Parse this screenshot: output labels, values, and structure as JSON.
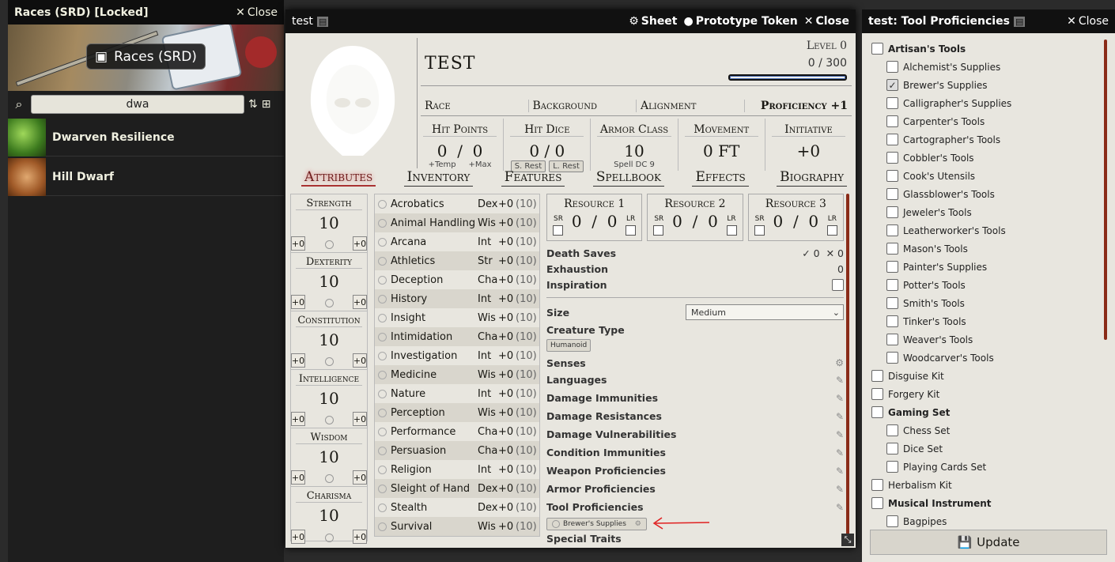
{
  "left_window": {
    "title": "Races (SRD) [Locked]",
    "close_label": "Close",
    "banner_label": "Races (SRD)",
    "search_value": "dwa",
    "results": [
      "Dwarven Resilience",
      "Hill Dwarf"
    ]
  },
  "sheet": {
    "window_title": "test",
    "sheet_label": "Sheet",
    "token_label": "Prototype Token",
    "close_label": "Close",
    "name": "TEST",
    "level": "Level 0",
    "xp": "0 / 300",
    "race": "Race",
    "background": "Background",
    "alignment": "Alignment",
    "proficiency": "Proficiency +1",
    "hp": {
      "title": "Hit Points",
      "value": "0  /  0",
      "temp": "+Temp",
      "max": "+Max"
    },
    "hd": {
      "title": "Hit Dice",
      "value": "0 / 0",
      "srest": "S. Rest",
      "lrest": "L. Rest"
    },
    "ac": {
      "title": "Armor Class",
      "value": "10",
      "dc": "Spell DC 9"
    },
    "mv": {
      "title": "Movement",
      "value": "0 FT"
    },
    "init": {
      "title": "Initiative",
      "value": "+0"
    },
    "tabs": [
      "Attributes",
      "Inventory",
      "Features",
      "Spellbook",
      "Effects",
      "Biography"
    ],
    "abilities": [
      {
        "name": "Strength",
        "score": "10",
        "mod": "+0",
        "save": "+0"
      },
      {
        "name": "Dexterity",
        "score": "10",
        "mod": "+0",
        "save": "+0"
      },
      {
        "name": "Constitution",
        "score": "10",
        "mod": "+0",
        "save": "+0"
      },
      {
        "name": "Intelligence",
        "score": "10",
        "mod": "+0",
        "save": "+0"
      },
      {
        "name": "Wisdom",
        "score": "10",
        "mod": "+0",
        "save": "+0"
      },
      {
        "name": "Charisma",
        "score": "10",
        "mod": "+0",
        "save": "+0"
      }
    ],
    "skills": [
      {
        "name": "Acrobatics",
        "ab": "Dex",
        "mod": "+0",
        "pas": "(10)"
      },
      {
        "name": "Animal Handling",
        "ab": "Wis",
        "mod": "+0",
        "pas": "(10)"
      },
      {
        "name": "Arcana",
        "ab": "Int",
        "mod": "+0",
        "pas": "(10)"
      },
      {
        "name": "Athletics",
        "ab": "Str",
        "mod": "+0",
        "pas": "(10)"
      },
      {
        "name": "Deception",
        "ab": "Cha",
        "mod": "+0",
        "pas": "(10)"
      },
      {
        "name": "History",
        "ab": "Int",
        "mod": "+0",
        "pas": "(10)"
      },
      {
        "name": "Insight",
        "ab": "Wis",
        "mod": "+0",
        "pas": "(10)"
      },
      {
        "name": "Intimidation",
        "ab": "Cha",
        "mod": "+0",
        "pas": "(10)"
      },
      {
        "name": "Investigation",
        "ab": "Int",
        "mod": "+0",
        "pas": "(10)"
      },
      {
        "name": "Medicine",
        "ab": "Wis",
        "mod": "+0",
        "pas": "(10)"
      },
      {
        "name": "Nature",
        "ab": "Int",
        "mod": "+0",
        "pas": "(10)"
      },
      {
        "name": "Perception",
        "ab": "Wis",
        "mod": "+0",
        "pas": "(10)"
      },
      {
        "name": "Performance",
        "ab": "Cha",
        "mod": "+0",
        "pas": "(10)"
      },
      {
        "name": "Persuasion",
        "ab": "Cha",
        "mod": "+0",
        "pas": "(10)"
      },
      {
        "name": "Religion",
        "ab": "Int",
        "mod": "+0",
        "pas": "(10)"
      },
      {
        "name": "Sleight of Hand",
        "ab": "Dex",
        "mod": "+0",
        "pas": "(10)"
      },
      {
        "name": "Stealth",
        "ab": "Dex",
        "mod": "+0",
        "pas": "(10)"
      },
      {
        "name": "Survival",
        "ab": "Wis",
        "mod": "+0",
        "pas": "(10)"
      }
    ],
    "resources": [
      {
        "title": "Resource 1",
        "value": "0  /  0",
        "sr": "SR",
        "lr": "LR"
      },
      {
        "title": "Resource 2",
        "value": "0  /  0",
        "sr": "SR",
        "lr": "LR"
      },
      {
        "title": "Resource 3",
        "value": "0  /  0",
        "sr": "SR",
        "lr": "LR"
      }
    ],
    "death_saves": {
      "label": "Death Saves",
      "success": "0",
      "fail": "0"
    },
    "exhaustion": {
      "label": "Exhaustion",
      "value": "0"
    },
    "inspiration": {
      "label": "Inspiration"
    },
    "size": {
      "label": "Size",
      "value": "Medium"
    },
    "creature_type": {
      "label": "Creature Type",
      "value": "Humanoid"
    },
    "traits": [
      "Senses",
      "Languages",
      "Damage Immunities",
      "Damage Resistances",
      "Damage Vulnerabilities",
      "Condition Immunities",
      "Weapon Proficiencies",
      "Armor Proficiencies",
      "Tool Proficiencies"
    ],
    "tool_tag": "Brewer's Supplies",
    "special_traits": "Special Traits"
  },
  "tools_window": {
    "title": "test: Tool Proficiencies",
    "close_label": "Close",
    "items": [
      {
        "label": "Artisan's Tools",
        "level": "p",
        "checked": false
      },
      {
        "label": "Alchemist's Supplies",
        "level": "c",
        "checked": false
      },
      {
        "label": "Brewer's Supplies",
        "level": "c",
        "checked": true
      },
      {
        "label": "Calligrapher's Supplies",
        "level": "c",
        "checked": false
      },
      {
        "label": "Carpenter's Tools",
        "level": "c",
        "checked": false
      },
      {
        "label": "Cartographer's Tools",
        "level": "c",
        "checked": false
      },
      {
        "label": "Cobbler's Tools",
        "level": "c",
        "checked": false
      },
      {
        "label": "Cook's Utensils",
        "level": "c",
        "checked": false
      },
      {
        "label": "Glassblower's Tools",
        "level": "c",
        "checked": false
      },
      {
        "label": "Jeweler's Tools",
        "level": "c",
        "checked": false
      },
      {
        "label": "Leatherworker's Tools",
        "level": "c",
        "checked": false
      },
      {
        "label": "Mason's Tools",
        "level": "c",
        "checked": false
      },
      {
        "label": "Painter's Supplies",
        "level": "c",
        "checked": false
      },
      {
        "label": "Potter's Tools",
        "level": "c",
        "checked": false
      },
      {
        "label": "Smith's Tools",
        "level": "c",
        "checked": false
      },
      {
        "label": "Tinker's Tools",
        "level": "c",
        "checked": false
      },
      {
        "label": "Weaver's Tools",
        "level": "c",
        "checked": false
      },
      {
        "label": "Woodcarver's Tools",
        "level": "c",
        "checked": false
      },
      {
        "label": "Disguise Kit",
        "level": "n",
        "checked": false
      },
      {
        "label": "Forgery Kit",
        "level": "n",
        "checked": false
      },
      {
        "label": "Gaming Set",
        "level": "p",
        "checked": false
      },
      {
        "label": "Chess Set",
        "level": "c",
        "checked": false
      },
      {
        "label": "Dice Set",
        "level": "c",
        "checked": false
      },
      {
        "label": "Playing Cards Set",
        "level": "c",
        "checked": false
      },
      {
        "label": "Herbalism Kit",
        "level": "n",
        "checked": false
      },
      {
        "label": "Musical Instrument",
        "level": "p",
        "checked": false
      },
      {
        "label": "Bagpipes",
        "level": "c",
        "checked": false
      }
    ],
    "update_label": "Update"
  },
  "colors": {
    "accent": "#8a2b18",
    "tab_active": "#6e1d1d",
    "annotation": "#e02020"
  }
}
